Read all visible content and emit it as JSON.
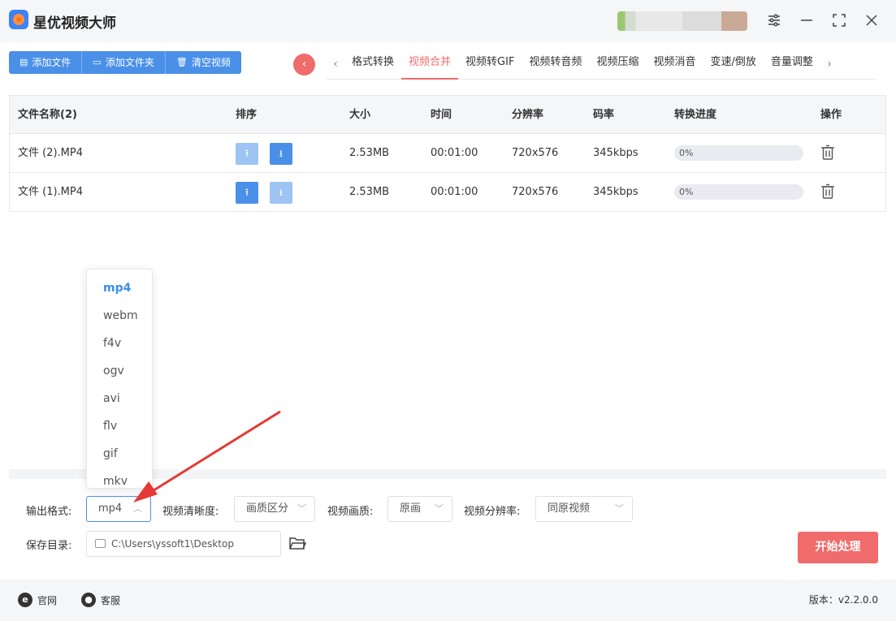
{
  "app": {
    "title": "星优视频大师"
  },
  "window_controls": [
    "settings-icon",
    "minimize-icon",
    "maximize-icon",
    "close-icon"
  ],
  "toolbar": {
    "add_file": "添加文件",
    "add_folder": "添加文件夹",
    "clear_videos": "清空视频"
  },
  "tabs": [
    {
      "label": "格式转换",
      "active": false
    },
    {
      "label": "视频合并",
      "active": true
    },
    {
      "label": "视频转GIF",
      "active": false
    },
    {
      "label": "视频转音频",
      "active": false
    },
    {
      "label": "视频压缩",
      "active": false
    },
    {
      "label": "视频消音",
      "active": false
    },
    {
      "label": "变速/倒放",
      "active": false
    },
    {
      "label": "音量调整",
      "active": false
    }
  ],
  "table": {
    "headers": {
      "name": "文件名称(2)",
      "sort": "排序",
      "size": "大小",
      "duration": "时间",
      "resolution": "分辨率",
      "bitrate": "码率",
      "progress": "转换进度",
      "action": "操作"
    },
    "rows": [
      {
        "name": "文件 (2).MP4",
        "size": "2.53MB",
        "duration": "00:01:00",
        "resolution": "720x576",
        "bitrate": "345kbps",
        "progress_label": "0%",
        "progress": 0,
        "up_enabled": false,
        "down_enabled": true
      },
      {
        "name": "文件 (1).MP4",
        "size": "2.53MB",
        "duration": "00:01:00",
        "resolution": "720x576",
        "bitrate": "345kbps",
        "progress_label": "0%",
        "progress": 0,
        "up_enabled": true,
        "down_enabled": false
      }
    ]
  },
  "format_dropdown": {
    "selected": "mp4",
    "options": [
      "mp4",
      "webm",
      "f4v",
      "ogv",
      "avi",
      "flv",
      "gif",
      "mkv"
    ]
  },
  "settings": {
    "output_format_label": "输出格式:",
    "output_format_value": "mp4",
    "clarity_label": "视频清晰度:",
    "clarity_value": "画质区分",
    "quality_label": "视频画质:",
    "quality_value": "原画",
    "resolution_label": "视频分辨率:",
    "resolution_value": "同原视频",
    "save_dir_label": "保存目录:",
    "save_dir_value": "C:\\Users\\yssoft1\\Desktop",
    "start_button": "开始处理"
  },
  "footer": {
    "website": "官网",
    "support": "客服",
    "version": "版本：v2.2.0.0"
  },
  "colors": {
    "primary": "#4a90e8",
    "accent": "#f06b6b",
    "annotation_arrow": "#e53935"
  }
}
